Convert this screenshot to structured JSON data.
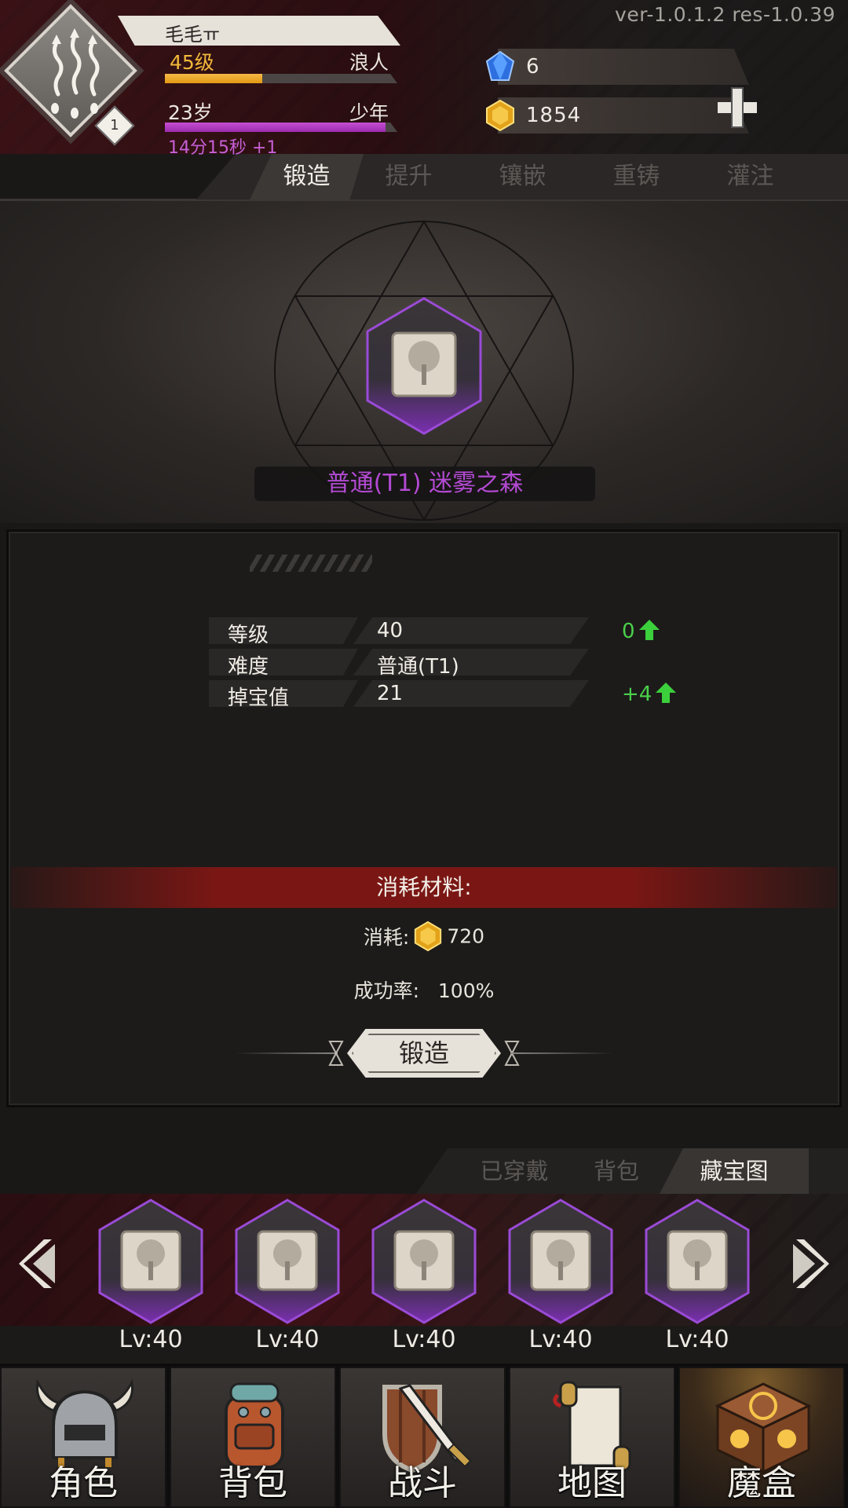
{
  "version": "ver-1.0.1.2  res-1.0.39",
  "player": {
    "name": "毛毛ㅠ",
    "rank": "1",
    "level_label": "45级",
    "class_label": "浪人",
    "xp_fraction": 0.42,
    "age_label": "23岁",
    "stage_label": "少年",
    "age_fraction": 0.95,
    "timer_label": "14分15秒 +1"
  },
  "currency": {
    "gems": "6",
    "gold": "1854"
  },
  "forge_tabs": [
    "锻造",
    "提升",
    "镶嵌",
    "重铸",
    "灌注"
  ],
  "forge_active_tab": 0,
  "item": {
    "name": "普通(T1) 迷雾之森"
  },
  "properties": [
    {
      "key": "等级",
      "value": "40",
      "delta": "0"
    },
    {
      "key": "难度",
      "value": "普通(T1)",
      "delta": ""
    },
    {
      "key": "掉宝值",
      "value": "21",
      "delta": "+4"
    }
  ],
  "cost": {
    "banner": "消耗材料:",
    "consume_label": "消耗:",
    "consume_amount": "720",
    "success_label": "成功率:",
    "success_value": "100%"
  },
  "forge_button": "锻造",
  "inventory_tabs": [
    "已穿戴",
    "背包",
    "藏宝图"
  ],
  "inventory_active_tab": 2,
  "inventory_slots": [
    {
      "level": "Lv:40"
    },
    {
      "level": "Lv:40"
    },
    {
      "level": "Lv:40"
    },
    {
      "level": "Lv:40"
    },
    {
      "level": "Lv:40"
    }
  ],
  "bottom_nav": [
    {
      "label": "角色",
      "icon": "helmet-icon"
    },
    {
      "label": "背包",
      "icon": "backpack-icon"
    },
    {
      "label": "战斗",
      "icon": "sword-shield-icon"
    },
    {
      "label": "地图",
      "icon": "map-scroll-icon"
    },
    {
      "label": "魔盒",
      "icon": "magic-box-icon"
    }
  ],
  "bottom_nav_active": 4,
  "colors": {
    "item_rarity": "#b34ad3",
    "gold_text": "#f1b83a",
    "increase": "#4bd04b",
    "banner_red": "#7a1714"
  }
}
